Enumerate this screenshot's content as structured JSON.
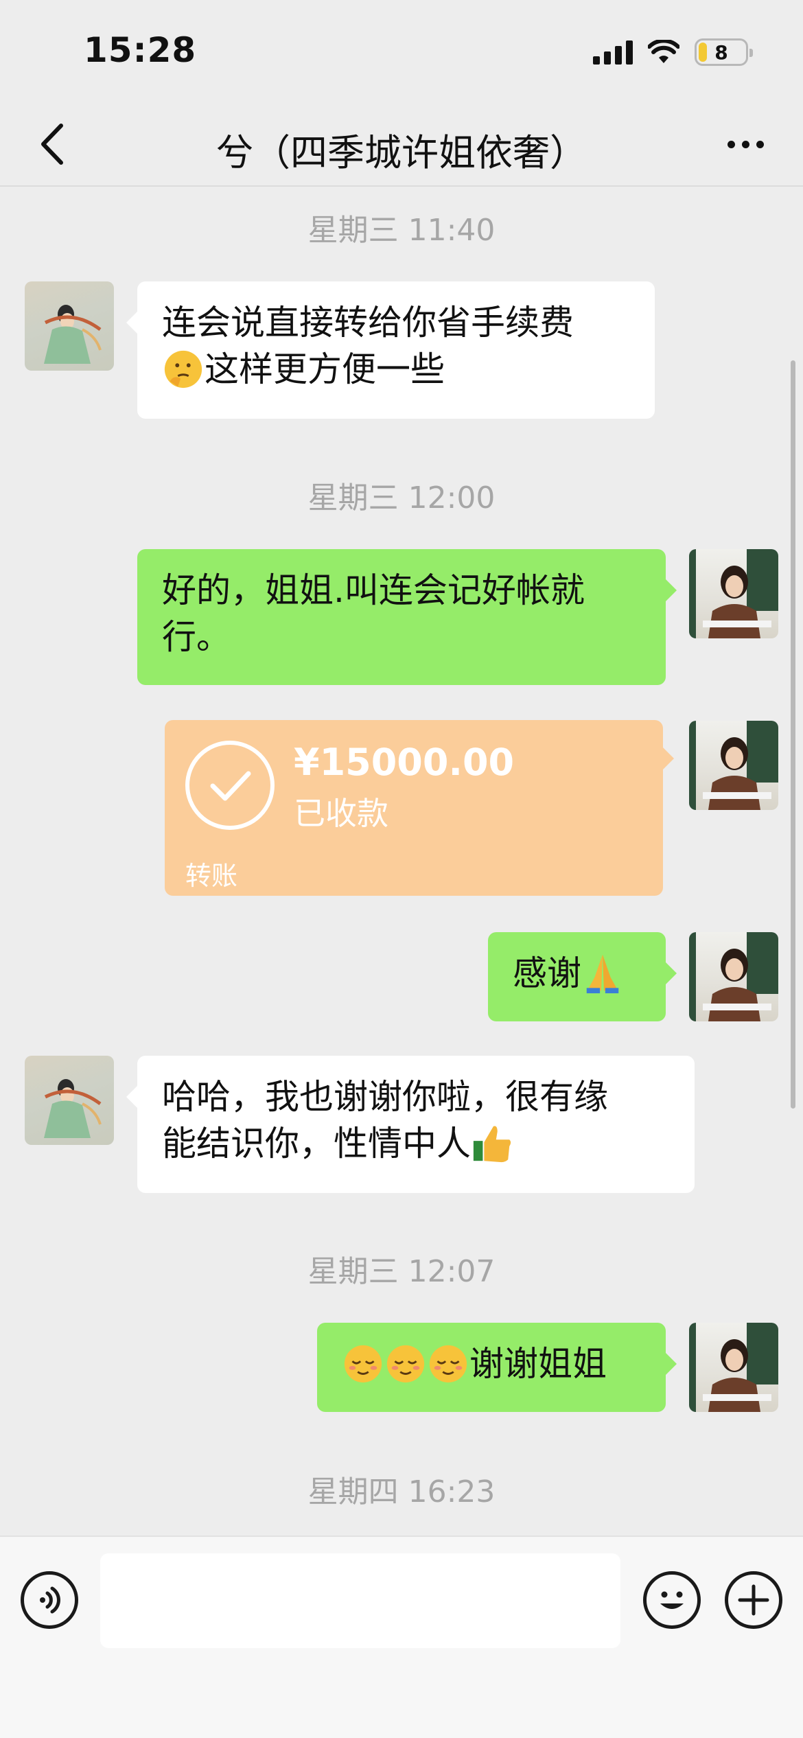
{
  "status_bar": {
    "time": "15:28",
    "battery": "8",
    "battery_level": 0.08,
    "battery_color": "#f3c934"
  },
  "nav": {
    "title": "兮（四季城许姐依奢）",
    "back_icon": "chevron-left-icon",
    "more_icon": "more-icon"
  },
  "colors": {
    "self_bubble": "#95ec69",
    "other_bubble": "#ffffff",
    "transfer_card": "#fbcd9a",
    "background": "#ededed"
  },
  "messages": [
    {
      "type": "time",
      "text": "星期三 11:40"
    },
    {
      "type": "text",
      "side": "left",
      "line1": "连会说直接转给你省手续费",
      "emoji": "thinking-face-emoji",
      "line2": "这样更方便一些"
    },
    {
      "type": "time",
      "text": "星期三 12:00"
    },
    {
      "type": "text",
      "side": "right",
      "line1": "好的，姐姐.叫连会记好帐就",
      "line2": "行。"
    },
    {
      "type": "transfer",
      "side": "right",
      "amount": "¥15000.00",
      "status": "已收款",
      "label": "转账"
    },
    {
      "type": "text",
      "side": "right",
      "text": "感谢",
      "emoji": "folded-hands-emoji"
    },
    {
      "type": "text",
      "side": "left",
      "line1": "哈哈，我也谢谢你啦，很有缘",
      "line2": "能结识你，性情中人",
      "emoji": "thumbs-up-emoji"
    },
    {
      "type": "time",
      "text": "星期三 12:07"
    },
    {
      "type": "text",
      "side": "right",
      "emojis": [
        "relieved-face-emoji",
        "relieved-face-emoji",
        "relieved-face-emoji"
      ],
      "text": "谢谢姐姐"
    },
    {
      "type": "time",
      "text": "星期四 16:23"
    }
  ],
  "input_bar": {
    "placeholder": "",
    "voice_icon": "voice-icon",
    "emoji_icon": "smiley-icon",
    "plus_icon": "plus-icon"
  }
}
